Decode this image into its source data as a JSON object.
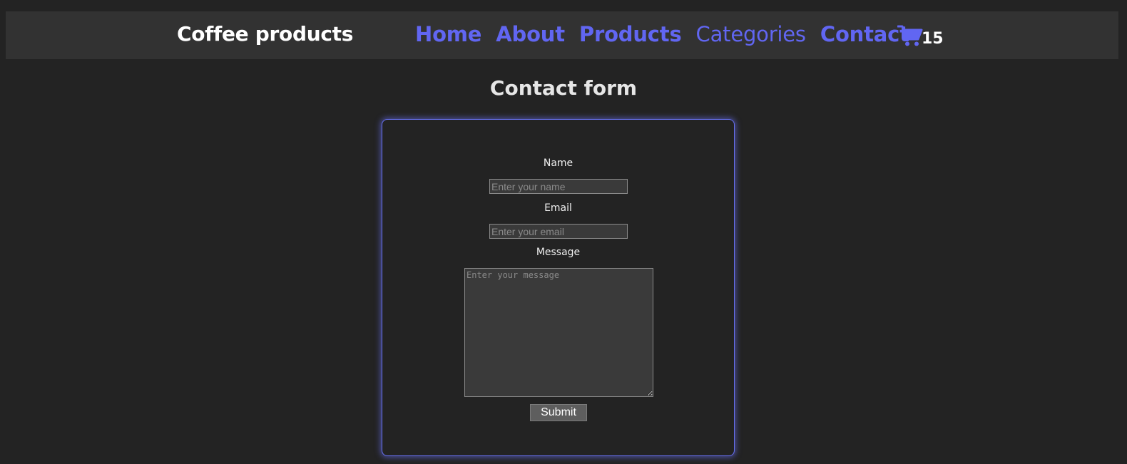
{
  "header": {
    "brand": "Coffee products",
    "nav": [
      {
        "label": "Home"
      },
      {
        "label": "About"
      },
      {
        "label": "Products"
      },
      {
        "label": "Categories"
      },
      {
        "label": "Contact"
      }
    ],
    "cart": {
      "icon": "cart-icon",
      "count": "15"
    }
  },
  "colors": {
    "background": "#232323",
    "navbar": "#323232",
    "accent": "#6166f2"
  },
  "main": {
    "title": "Contact form",
    "form": {
      "name_label": "Name",
      "name_placeholder": "Enter your name",
      "email_label": "Email",
      "email_placeholder": "Enter your email",
      "message_label": "Message",
      "message_placeholder": "Enter your message",
      "submit_label": "Submit"
    }
  }
}
